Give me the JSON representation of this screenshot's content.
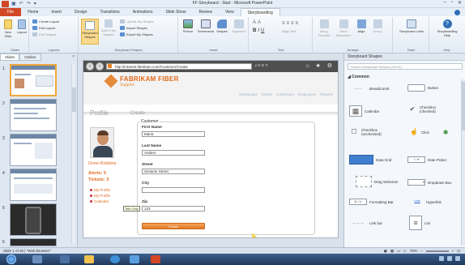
{
  "window": {
    "title": "FF Storyboard - Start - Microsoft PowerPoint",
    "controls": [
      "–",
      "▫",
      "✕"
    ]
  },
  "ribbon_tabs": [
    "File",
    "Home",
    "Insert",
    "Design",
    "Transitions",
    "Animations",
    "Slide Show",
    "Review",
    "View",
    "Storyboarding"
  ],
  "ribbon": {
    "slides": {
      "new_slide": "New Slide",
      "layout": "Layout",
      "create_layout": "Create Layout",
      "edit_layout": "Edit Layout",
      "edit_shapes": "Edit Shapes",
      "label": "Slides",
      "layouts_label": "Layouts"
    },
    "storyboard": {
      "shapes": "Storyboard Shapes",
      "add_to_my_shapes": "Add to My Shapes",
      "update_my_shapes": "Update My Shapes",
      "import_shapes": "Import Shapes",
      "export_my_shapes": "Export My Shapes",
      "label": "Storyboard Shapes"
    },
    "insert": {
      "picture": "Picture",
      "screenshot": "Screenshot",
      "shapes": "Shapes",
      "hyperlink": "Hyperlink",
      "label": "Insert"
    },
    "text": {
      "label": "Text",
      "align_text": "Align Text"
    },
    "arrange": {
      "bring_forward": "Bring Forward",
      "send_backward": "Send Backward",
      "align": "Align",
      "group": "Group",
      "label": "Arrange"
    },
    "team": {
      "storyboard_links": "Storyboard Links",
      "label": "Team"
    },
    "help": {
      "storyboarding_help": "Storyboarding Help",
      "label": "Help"
    }
  },
  "slides_pane": {
    "tabs": [
      "Slides",
      "Outline"
    ],
    "close": "×",
    "slide_numbers": [
      "1",
      "2",
      "3",
      "4",
      "5",
      "6"
    ]
  },
  "slide": {
    "browser": {
      "url": "http://intranet.fabrikam.com/Customer/Create",
      "search_controls": "ρ ▾ ⊡ ✕",
      "icons": "⌂ ★ ⚙"
    },
    "site": {
      "name": "FABRIKAM FIBER",
      "subtitle": "Support",
      "nav": [
        "Dashboard",
        "Tickets",
        "Customers",
        "Employees",
        "Reports"
      ]
    },
    "profile_heading": "Profile",
    "create_heading": "Create",
    "employee_name": "Drew Robbins",
    "alerts": "Alerts: 5",
    "tickets": "Tickets: 3",
    "left_links": [
      "My Profile",
      "My Profile",
      "Calendar"
    ],
    "tooltip": "Title Only",
    "form": {
      "legend": "Customer",
      "fields": [
        {
          "label": "First Name",
          "value": "Maria"
        },
        {
          "label": "Last Name",
          "value": "Anders"
        },
        {
          "label": "Street",
          "value": "Sesame Street"
        },
        {
          "label": "City",
          "value": ""
        },
        {
          "label": "Zip",
          "value": "123"
        }
      ],
      "submit": "Create"
    }
  },
  "shapes_pane": {
    "title": "Storyboard Shapes",
    "search_placeholder": "Search Storyboard Shapes (Ctrl+E)",
    "section": "Common",
    "shapes": [
      {
        "label": "Breadcrumb",
        "glyph": "— —"
      },
      {
        "label": "Button",
        "glyph": ""
      },
      {
        "label": "Calendar",
        "glyph": "▦"
      },
      {
        "label": "Checkbox (checked)",
        "glyph": "✔"
      },
      {
        "label": "Checkbox (unchecked)",
        "glyph": "☐"
      },
      {
        "label": "Click",
        "glyph": "☝"
      },
      {
        "label": "Data Grid",
        "glyph": ""
      },
      {
        "label": "Date Picker",
        "glyph": "/ / ▾"
      },
      {
        "label": "Drag Selection",
        "glyph": ""
      },
      {
        "label": "Dropdown Box",
        "glyph": "▾"
      },
      {
        "label": "Formatting Bar",
        "glyph": "B I U"
      },
      {
        "label": "Hyperlink",
        "glyph": "Link"
      },
      {
        "label": "Link bar",
        "glyph": "— — —"
      },
      {
        "label": "List",
        "glyph": "≡"
      }
    ]
  },
  "status": {
    "left": "Slide 1 of 26  |  \"Web Browser\"",
    "zoom": "75%"
  },
  "colors": {
    "accent_orange": "#e06a1b",
    "powerpoint_file_tab": "#d24726",
    "ribbon_bg": "#e3ebf4",
    "selection_blue": "#3f7fd0"
  }
}
